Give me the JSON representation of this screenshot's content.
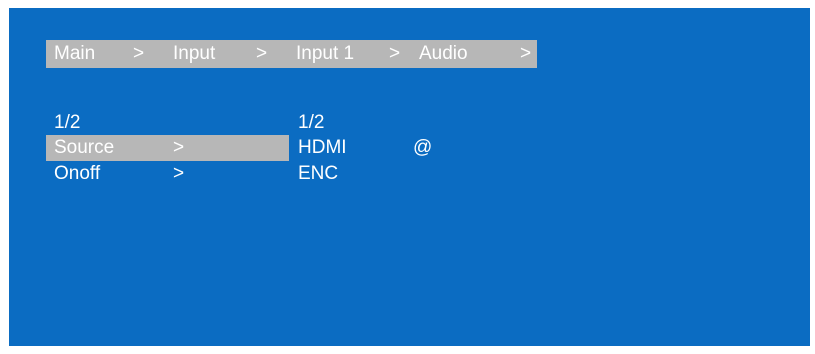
{
  "breadcrumb": {
    "main": "Main",
    "sep1": ">",
    "input": "Input",
    "sep2": ">",
    "input1": "Input 1",
    "sep3": ">",
    "audio": "Audio",
    "sep4": ">"
  },
  "left_panel": {
    "page": "1/2",
    "items": [
      {
        "label": "Source",
        "arrow": ">",
        "selected": true
      },
      {
        "label": "Onoff",
        "arrow": ">",
        "selected": false
      }
    ]
  },
  "right_panel": {
    "page": "1/2",
    "values": [
      "HDMI",
      "ENC"
    ],
    "marker": "@"
  },
  "colors": {
    "background": "#0b6cc2",
    "highlight": "#b7b7b7",
    "text": "#ffffff"
  }
}
